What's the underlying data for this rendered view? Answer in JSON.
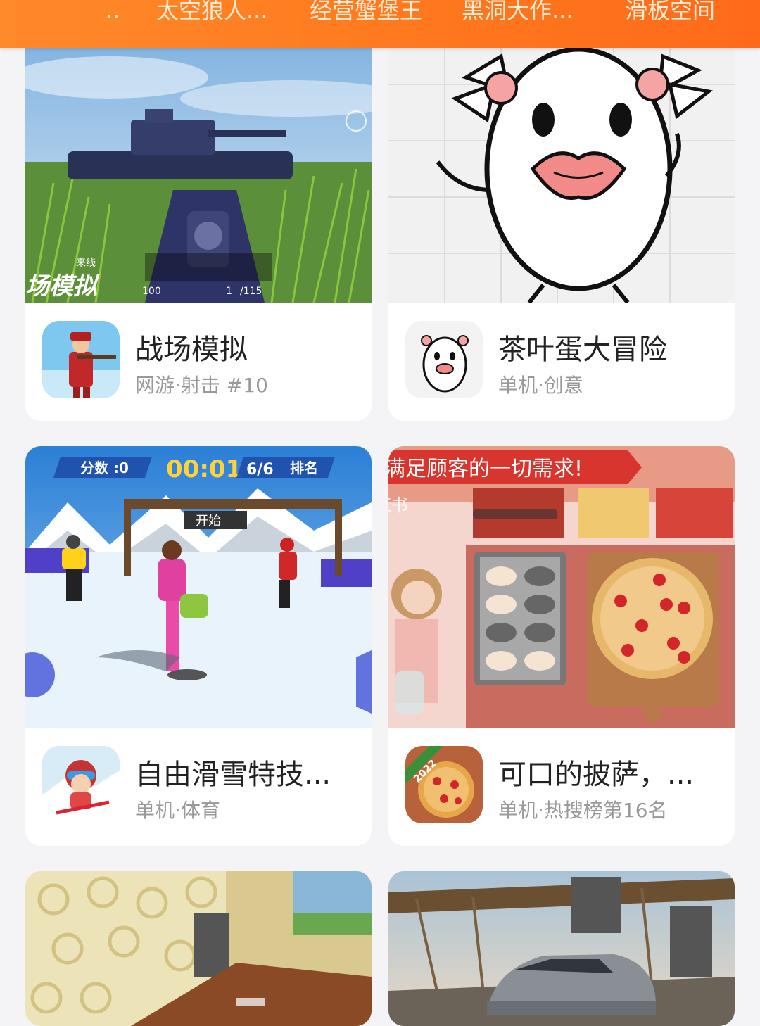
{
  "top_tags": [
    "..",
    "太空狼人...",
    "经营蟹堡王",
    "黑洞大作...",
    "滑板空间"
  ],
  "games": [
    {
      "title": "战场模拟",
      "subtitle": "网游·射击 #10",
      "thumb_overlay": "场模拟",
      "thumb_overlay_small": "来线",
      "hud_ammo": "100",
      "hud_mag": "1",
      "hud_total": "/115"
    },
    {
      "title": "茶叶蛋大冒险",
      "subtitle": "单机·创意"
    },
    {
      "title": "自由滑雪特技...",
      "subtitle": "单机·体育",
      "hud_score_label": "分数 :0",
      "hud_time": "00:01",
      "hud_rank": "6/6",
      "hud_rank_label": "排名",
      "start_banner": "开始"
    },
    {
      "title": "可口的披萨，...",
      "subtitle": "单机·热搜榜第16名",
      "banner_text": "满足顾客的一切需求!",
      "watermark": "小红书",
      "icon_badge": "2022"
    },
    {
      "title": "",
      "subtitle": ""
    },
    {
      "title": "",
      "subtitle": ""
    }
  ],
  "colors": {
    "accent": "#ff7a1e",
    "card_bg": "#ffffff",
    "page_bg": "#f4f4f6"
  }
}
